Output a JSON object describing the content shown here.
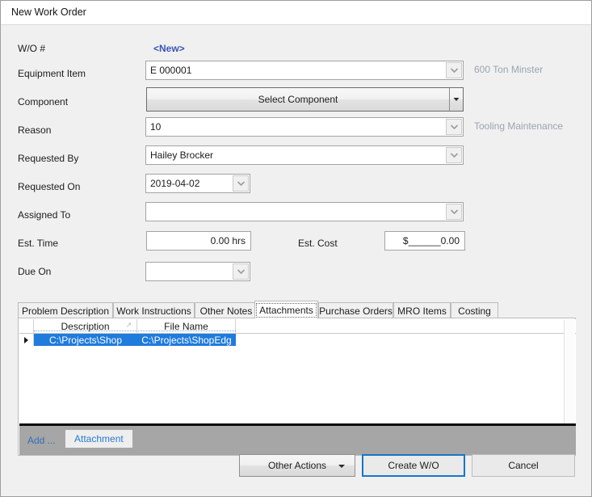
{
  "window": {
    "title": "New Work Order"
  },
  "form": {
    "wo_number": {
      "label": "W/O #",
      "value": "<New>"
    },
    "equipment_item": {
      "label": "Equipment Item",
      "value": "E 000001",
      "side_note": "600 Ton Minster"
    },
    "component": {
      "label": "Component",
      "button_label": "Select Component"
    },
    "reason": {
      "label": "Reason",
      "value": "10",
      "side_note": "Tooling Maintenance"
    },
    "requested_by": {
      "label": "Requested By",
      "value": "Hailey Brocker"
    },
    "requested_on": {
      "label": "Requested On",
      "value": "2019-04-02"
    },
    "assigned_to": {
      "label": "Assigned To",
      "value": ""
    },
    "est_time": {
      "label": "Est. Time",
      "value": "0.00 hrs"
    },
    "est_cost": {
      "label": "Est. Cost",
      "value": "$______0.00"
    },
    "due_on": {
      "label": "Due On",
      "value": ""
    }
  },
  "tabs": {
    "items": [
      {
        "label": "Problem Description",
        "active": false
      },
      {
        "label": "Work Instructions",
        "active": false
      },
      {
        "label": "Other Notes",
        "active": false
      },
      {
        "label": "Attachments",
        "active": true
      },
      {
        "label": "Purchase Orders",
        "active": false
      },
      {
        "label": "MRO Items",
        "active": false
      },
      {
        "label": "Costing",
        "active": false
      }
    ]
  },
  "attachments": {
    "columns": [
      "Description",
      "File Name"
    ],
    "sort_indicator": "↗",
    "rows": [
      {
        "selected": true,
        "description": "C:\\Projects\\Shop",
        "file_name": "C:\\Projects\\ShopEdg"
      }
    ],
    "add_link": "Add ...",
    "attachment_button": "Attachment"
  },
  "footer": {
    "other_actions": "Other Actions",
    "create_wo": "Create W/O",
    "cancel": "Cancel"
  },
  "colors": {
    "accent_blue": "#3a55b4",
    "selection_blue": "#1f7bdc",
    "link_blue": "#2f6fba",
    "side_note": "#9aa5b1",
    "default_button_border": "#1776c8"
  }
}
